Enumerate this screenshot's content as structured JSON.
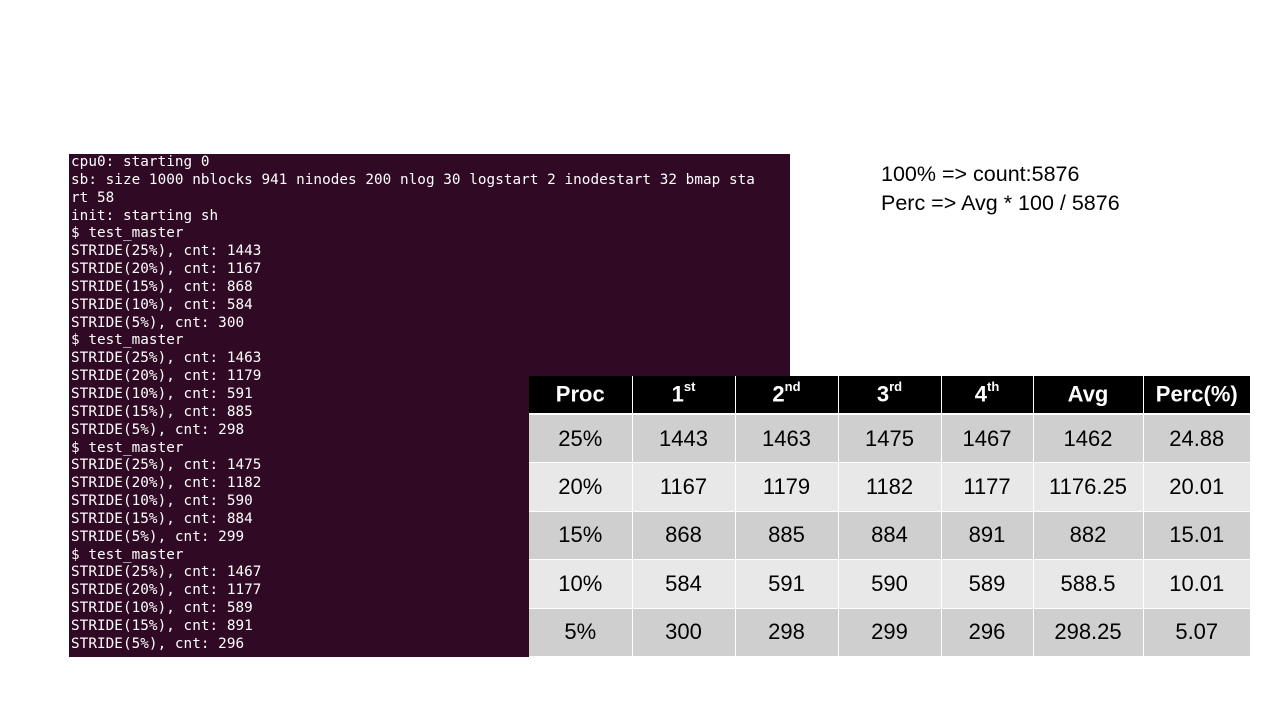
{
  "terminal": {
    "lines": [
      "cpu0: starting 0",
      "sb: size 1000 nblocks 941 ninodes 200 nlog 30 logstart 2 inodestart 32 bmap sta",
      "rt 58",
      "init: starting sh",
      "$ test_master",
      "STRIDE(25%), cnt: 1443",
      "STRIDE(20%), cnt: 1167",
      "STRIDE(15%), cnt: 868",
      "STRIDE(10%), cnt: 584",
      "STRIDE(5%), cnt: 300",
      "$ test_master",
      "STRIDE(25%), cnt: 1463",
      "STRIDE(20%), cnt: 1179",
      "STRIDE(10%), cnt: 591",
      "STRIDE(15%), cnt: 885",
      "STRIDE(5%), cnt: 298",
      "$ test_master",
      "STRIDE(25%), cnt: 1475",
      "STRIDE(20%), cnt: 1182",
      "STRIDE(10%), cnt: 590",
      "STRIDE(15%), cnt: 884",
      "STRIDE(5%), cnt: 299",
      "$ test_master",
      "STRIDE(25%), cnt: 1467",
      "STRIDE(20%), cnt: 1177",
      "STRIDE(10%), cnt: 589",
      "STRIDE(15%), cnt: 891",
      "STRIDE(5%), cnt: 296"
    ],
    "background": "#300a24",
    "text_color": "#ffffff"
  },
  "notes": {
    "line1": "100% => count:5876",
    "line2": "Perc => Avg * 100 / 5876"
  },
  "table": {
    "headers": [
      {
        "base": "Proc",
        "sup": ""
      },
      {
        "base": "1",
        "sup": "st"
      },
      {
        "base": "2",
        "sup": "nd"
      },
      {
        "base": "3",
        "sup": "rd"
      },
      {
        "base": "4",
        "sup": "th"
      },
      {
        "base": "Avg",
        "sup": ""
      },
      {
        "base": "Perc(%)",
        "sup": ""
      }
    ],
    "rows": [
      [
        "25%",
        "1443",
        "1463",
        "1475",
        "1467",
        "1462",
        "24.88"
      ],
      [
        "20%",
        "1167",
        "1179",
        "1182",
        "1177",
        "1176.25",
        "20.01"
      ],
      [
        "15%",
        "868",
        "885",
        "884",
        "891",
        "882",
        "15.01"
      ],
      [
        "10%",
        "584",
        "591",
        "590",
        "589",
        "588.5",
        "10.01"
      ],
      [
        "5%",
        "300",
        "298",
        "299",
        "296",
        "298.25",
        "5.07"
      ]
    ],
    "header_bg": "#000000",
    "row_bg_odd": "#cfcfcf",
    "row_bg_even": "#e8e8e8"
  }
}
